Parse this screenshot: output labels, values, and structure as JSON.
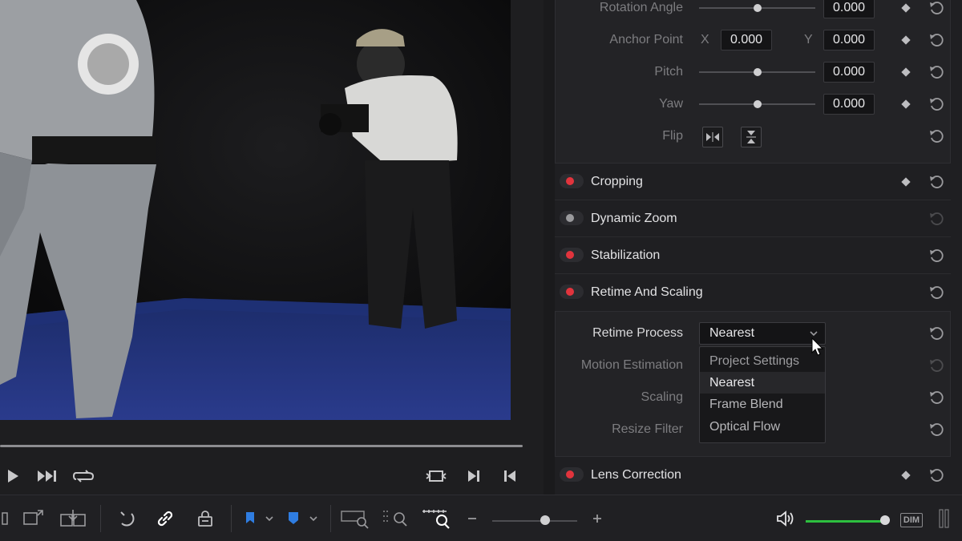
{
  "viewer": {
    "progress": 1.0,
    "transport": [
      {
        "name": "play-icon"
      },
      {
        "name": "skip-to-end-icon"
      },
      {
        "name": "loop-icon"
      },
      {
        "name": "match-frame-icon"
      },
      {
        "name": "next-edit-icon"
      },
      {
        "name": "previous-edit-icon"
      }
    ]
  },
  "transform": {
    "rotation_angle": {
      "label": "Rotation Angle",
      "value": "0.000"
    },
    "anchor_point": {
      "label": "Anchor Point",
      "x_label": "X",
      "x_value": "0.000",
      "y_label": "Y",
      "y_value": "0.000"
    },
    "pitch": {
      "label": "Pitch",
      "value": "0.000"
    },
    "yaw": {
      "label": "Yaw",
      "value": "0.000"
    },
    "flip": {
      "label": "Flip",
      "buttons": [
        "flip-horizontal-icon",
        "flip-vertical-icon"
      ]
    }
  },
  "sections": {
    "cropping": {
      "title": "Cropping",
      "enabled": true
    },
    "dynamic_zoom": {
      "title": "Dynamic Zoom",
      "enabled": false
    },
    "stabilization": {
      "title": "Stabilization",
      "enabled": true
    },
    "retime_scaling": {
      "title": "Retime And Scaling",
      "enabled": true
    },
    "lens_correction": {
      "title": "Lens Correction",
      "enabled": true
    }
  },
  "retime": {
    "retime_process": {
      "label": "Retime Process",
      "value": "Nearest"
    },
    "motion_estimation": {
      "label": "Motion Estimation"
    },
    "scaling": {
      "label": "Scaling"
    },
    "resize_filter": {
      "label": "Resize Filter"
    },
    "dropdown_options": [
      "Project Settings",
      "Nearest",
      "Frame Blend",
      "Optical Flow"
    ],
    "selected_option": "Nearest"
  },
  "toolbar": {
    "dim_label": "DIM",
    "zoom_level": 0.62,
    "volume_level": 1.0,
    "colors": {
      "accent_volume": "#2dbf3f",
      "record_red": "#e2343d",
      "marker_blue": "#2f7de1"
    }
  }
}
